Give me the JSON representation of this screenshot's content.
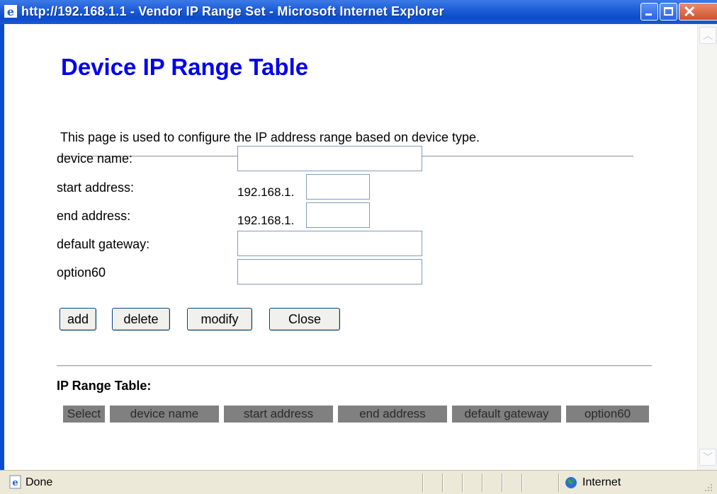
{
  "window": {
    "title": "http://192.168.1.1 - Vendor IP Range Set - Microsoft Internet Explorer"
  },
  "page": {
    "title": "Device IP Range Table",
    "description": "This page is used to configure the IP address range based on device type."
  },
  "form": {
    "device_name": {
      "label": "device name:",
      "value": ""
    },
    "start_address": {
      "label": "start address:",
      "prefix": "192.168.1.",
      "value": ""
    },
    "end_address": {
      "label": "end address:",
      "prefix": "192.168.1.",
      "value": ""
    },
    "default_gateway": {
      "label": "default gateway:",
      "value": ""
    },
    "option60": {
      "label": "option60",
      "value": ""
    }
  },
  "buttons": {
    "add": "add",
    "delete": "delete",
    "modify": "modify",
    "close": "Close"
  },
  "table": {
    "heading": "IP Range Table:",
    "columns": [
      "Select",
      "device name",
      "start address",
      "end address",
      "default gateway",
      "option60"
    ]
  },
  "statusbar": {
    "status": "Done",
    "zone": "Internet"
  },
  "colors": {
    "titlebar": "#0b4ccc",
    "page_title": "#0000ee",
    "table_header": "#808080"
  }
}
